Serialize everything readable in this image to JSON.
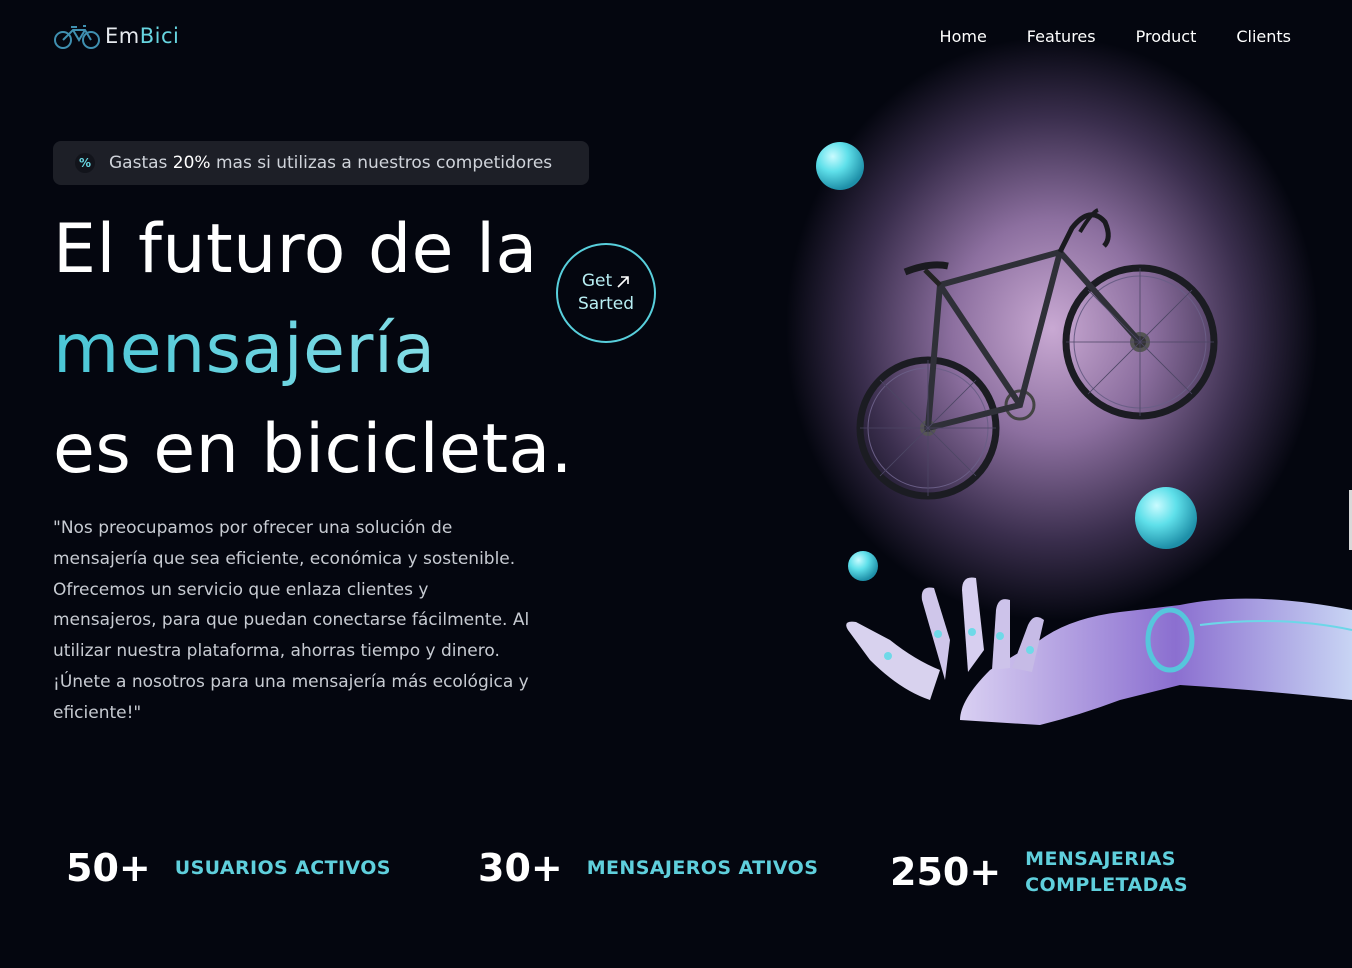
{
  "brand": {
    "name_part1": "Em",
    "name_part2": "Bici",
    "logo_icon": "bicycle-icon"
  },
  "nav": {
    "items": [
      {
        "label": "Home"
      },
      {
        "label": "Features"
      },
      {
        "label": "Product"
      },
      {
        "label": "Clients"
      }
    ]
  },
  "badge": {
    "icon": "percent-icon",
    "icon_glyph": "%",
    "text_before": "Gastas ",
    "highlight": "20%",
    "text_after": " mas si utilizas a nuestros competidores"
  },
  "hero": {
    "line1": "El futuro de la",
    "line2": "mensajería",
    "line3": "es en bicicleta.",
    "cta_line1": "Get",
    "cta_line2": "Sarted",
    "description": "\"Nos preocupamos por ofrecer una solución de mensajería que sea eficiente, económica y sostenible. Ofrecemos un servicio que enlaza clientes y mensajeros, para que puedan conectarse fácilmente. Al utilizar nuestra plataforma, ahorras tiempo y dinero. ¡Únete a nosotros para una mensajería más ecológica y eficiente!\""
  },
  "stats": [
    {
      "value": "50+",
      "label_line1": "USUARIOS ACTIVOS",
      "label_line2": ""
    },
    {
      "value": "30+",
      "label_line1": "MENSAJEROS ATIVOS",
      "label_line2": ""
    },
    {
      "value": "250+",
      "label_line1": "MENSAJERIAS",
      "label_line2": "COMPLETADAS"
    }
  ],
  "colors": {
    "background": "#04060f",
    "accent": "#5fcfdc",
    "text": "#ffffff"
  }
}
